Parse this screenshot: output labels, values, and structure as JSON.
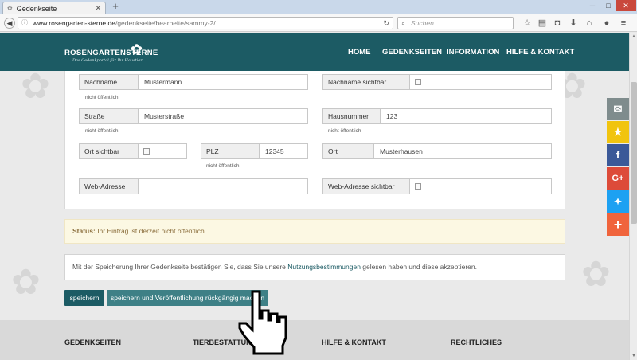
{
  "browser": {
    "tab_title": "Gedenkseite",
    "new_tab": "+",
    "url_host": "www.rosengarten-sterne.de",
    "url_path": "/gedenkseite/bearbeite/sammy-2/",
    "search_placeholder": "Suchen"
  },
  "site": {
    "logo_text": "ROSENGARTENSTERNE",
    "logo_tagline": "Das Gedenkportal für Ihr Haustier",
    "nav": [
      "HOME",
      "GEDENKSEITEN",
      "INFORMATION",
      "HILFE & KONTAKT"
    ]
  },
  "form": {
    "nachname": {
      "label": "Nachname",
      "value": "Mustermann",
      "hint": "nicht öffentlich"
    },
    "nachname_sichtbar": {
      "label": "Nachname sichtbar"
    },
    "strasse": {
      "label": "Straße",
      "value": "Musterstraße",
      "hint": "nicht öffentlich"
    },
    "hausnummer": {
      "label": "Hausnummer",
      "value": "123",
      "hint": "nicht öffentlich"
    },
    "ort_sichtbar": {
      "label": "Ort sichtbar"
    },
    "plz": {
      "label": "PLZ",
      "value": "12345",
      "hint": "nicht öffentlich"
    },
    "ort": {
      "label": "Ort",
      "value": "Musterhausen"
    },
    "web_adresse": {
      "label": "Web-Adresse",
      "value": ""
    },
    "web_adresse_sichtbar": {
      "label": "Web-Adresse sichtbar"
    }
  },
  "status": {
    "label": "Status:",
    "text": "Ihr Eintrag ist derzeit nicht öffentlich"
  },
  "consent": {
    "before": "Mit der Speicherung Ihrer Gedenkseite bestätigen Sie, dass Sie unsere ",
    "link": "Nutzungsbestimmungen",
    "after": " gelesen haben und diese akzeptieren."
  },
  "buttons": {
    "save": "speichern",
    "save_unpublish": "speichern und Veröffentlichung rückgängig machen"
  },
  "footer": [
    "GEDENKSEITEN",
    "TIERBESTATTUNG",
    "HILFE & KONTAKT",
    "RECHTLICHES"
  ],
  "share": [
    {
      "icon": "mail-icon",
      "glyph": "✉",
      "color": "#7f8c8d"
    },
    {
      "icon": "star-icon",
      "glyph": "★",
      "color": "#f1c40f"
    },
    {
      "icon": "facebook-icon",
      "glyph": "f",
      "color": "#3b5998"
    },
    {
      "icon": "google-plus-icon",
      "glyph": "G+",
      "color": "#dd4b39"
    },
    {
      "icon": "twitter-icon",
      "glyph": "🐦",
      "color": "#1da1f2"
    },
    {
      "icon": "more-icon",
      "glyph": "+",
      "color": "#f0643c"
    }
  ],
  "colors": {
    "brand": "#1c5b64",
    "brand_light": "#3e8086",
    "status_bg": "#fcf8e3"
  }
}
